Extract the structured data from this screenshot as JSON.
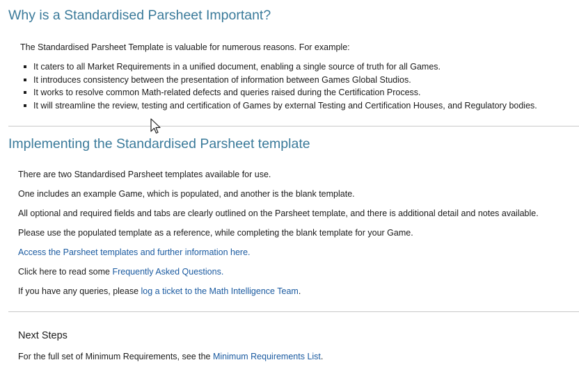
{
  "section1": {
    "title": "Why is a Standardised Parsheet Important?",
    "intro": "The Standardised Parsheet Template is valuable for numerous reasons. For example:",
    "bullets": [
      "It caters to all Market Requirements in a unified document, enabling a single source of truth for all Games.",
      "It introduces consistency between the presentation of information between Games Global Studios.",
      "It works to resolve common Math-related defects and queries raised during the Certification Process.",
      "It will streamline the review, testing and certification of Games by external Testing and Certification Houses, and Regulatory bodies."
    ]
  },
  "section2": {
    "title": "Implementing the Standardised Parsheet template",
    "p1": "There are two Standardised Parsheet templates available for use.",
    "p2": "One includes an example Game, which is populated, and another is the blank template.",
    "p3": "All optional and required fields and tabs are clearly outlined on the Parsheet template, and there is additional detail and notes available.",
    "p4": "Please use the populated template as a reference, while completing the blank template for your Game.",
    "access_link": "Access the Parsheet templates and further information here.",
    "faq_prefix": "Click here to read some ",
    "faq_link": "Frequently Asked Questions.",
    "queries_prefix": "If you have any queries, please ",
    "queries_link": "log a ticket to the Math Intelligence Team",
    "queries_suffix": "."
  },
  "section3": {
    "title": "Next Steps",
    "text_prefix": "For the full set of Minimum Requirements, see the ",
    "text_link": "Minimum Requirements List",
    "text_suffix": "."
  },
  "colors": {
    "heading": "#3a7a9a",
    "link": "#1a5aa0",
    "rule": "#c8c8c8"
  },
  "cursor_icon": "mouse-pointer-icon"
}
